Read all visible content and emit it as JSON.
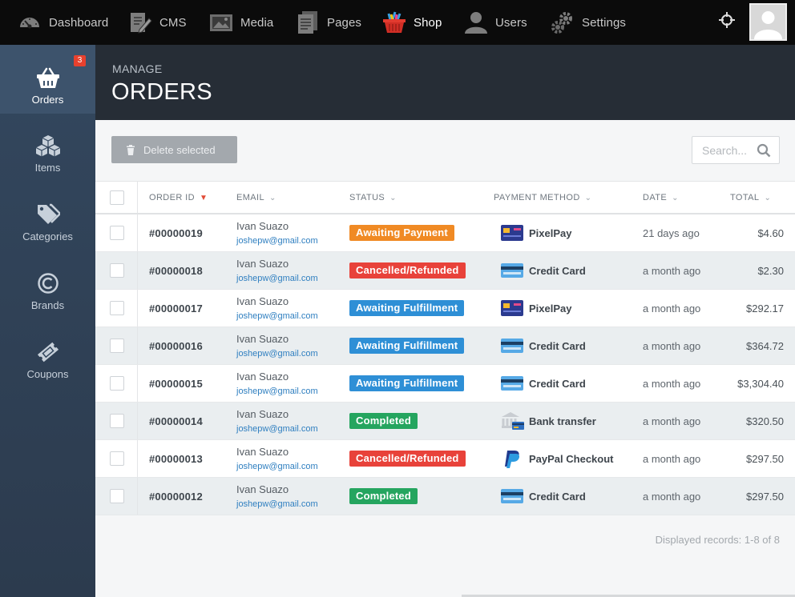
{
  "topnav": {
    "items": [
      {
        "label": "Dashboard",
        "icon": "gauge-icon"
      },
      {
        "label": "CMS",
        "icon": "document-edit-icon"
      },
      {
        "label": "Media",
        "icon": "image-icon"
      },
      {
        "label": "Pages",
        "icon": "pages-icon"
      },
      {
        "label": "Shop",
        "icon": "basket-icon",
        "active": true
      },
      {
        "label": "Users",
        "icon": "user-icon"
      },
      {
        "label": "Settings",
        "icon": "gears-icon"
      }
    ]
  },
  "sidebar": {
    "items": [
      {
        "label": "Orders",
        "icon": "basket-icon",
        "badge": "3",
        "active": true
      },
      {
        "label": "Items",
        "icon": "cubes-icon"
      },
      {
        "label": "Categories",
        "icon": "tags-icon"
      },
      {
        "label": "Brands",
        "icon": "copyright-icon"
      },
      {
        "label": "Coupons",
        "icon": "ticket-icon"
      }
    ]
  },
  "header": {
    "section": "MANAGE",
    "title": "ORDERS"
  },
  "toolbar": {
    "delete_label": "Delete selected",
    "search_placeholder": "Search..."
  },
  "table": {
    "columns": [
      "ORDER ID",
      "EMAIL",
      "STATUS",
      "PAYMENT METHOD",
      "DATE",
      "TOTAL"
    ],
    "rows": [
      {
        "id": "#00000019",
        "name": "Ivan Suazo",
        "email": "joshepw@gmail.com",
        "status": "Awaiting Payment",
        "status_color": "#f08a24",
        "payment": "PixelPay",
        "payment_icon": "pixelpay-icon",
        "date": "21 days ago",
        "total": "$4.60"
      },
      {
        "id": "#00000018",
        "name": "Ivan Suazo",
        "email": "joshepw@gmail.com",
        "status": "Cancelled/Refunded",
        "status_color": "#e8423a",
        "payment": "Credit Card",
        "payment_icon": "credit-card-icon",
        "date": "a month ago",
        "total": "$2.30"
      },
      {
        "id": "#00000017",
        "name": "Ivan Suazo",
        "email": "joshepw@gmail.com",
        "status": "Awaiting Fulfillment",
        "status_color": "#2e8fd6",
        "payment": "PixelPay",
        "payment_icon": "pixelpay-icon",
        "date": "a month ago",
        "total": "$292.17"
      },
      {
        "id": "#00000016",
        "name": "Ivan Suazo",
        "email": "joshepw@gmail.com",
        "status": "Awaiting Fulfillment",
        "status_color": "#2e8fd6",
        "payment": "Credit Card",
        "payment_icon": "credit-card-icon",
        "date": "a month ago",
        "total": "$364.72"
      },
      {
        "id": "#00000015",
        "name": "Ivan Suazo",
        "email": "joshepw@gmail.com",
        "status": "Awaiting Fulfillment",
        "status_color": "#2e8fd6",
        "payment": "Credit Card",
        "payment_icon": "credit-card-icon",
        "date": "a month ago",
        "total": "$3,304.40"
      },
      {
        "id": "#00000014",
        "name": "Ivan Suazo",
        "email": "joshepw@gmail.com",
        "status": "Completed",
        "status_color": "#25a55f",
        "payment": "Bank transfer",
        "payment_icon": "bank-icon",
        "date": "a month ago",
        "total": "$320.50"
      },
      {
        "id": "#00000013",
        "name": "Ivan Suazo",
        "email": "joshepw@gmail.com",
        "status": "Cancelled/Refunded",
        "status_color": "#e8423a",
        "payment": "PayPal Checkout",
        "payment_icon": "paypal-icon",
        "date": "a month ago",
        "total": "$297.50"
      },
      {
        "id": "#00000012",
        "name": "Ivan Suazo",
        "email": "joshepw@gmail.com",
        "status": "Completed",
        "status_color": "#25a55f",
        "payment": "Credit Card",
        "payment_icon": "credit-card-icon",
        "date": "a month ago",
        "total": "$297.50"
      }
    ]
  },
  "footer": {
    "records": "Displayed records: 1-8 of 8"
  }
}
